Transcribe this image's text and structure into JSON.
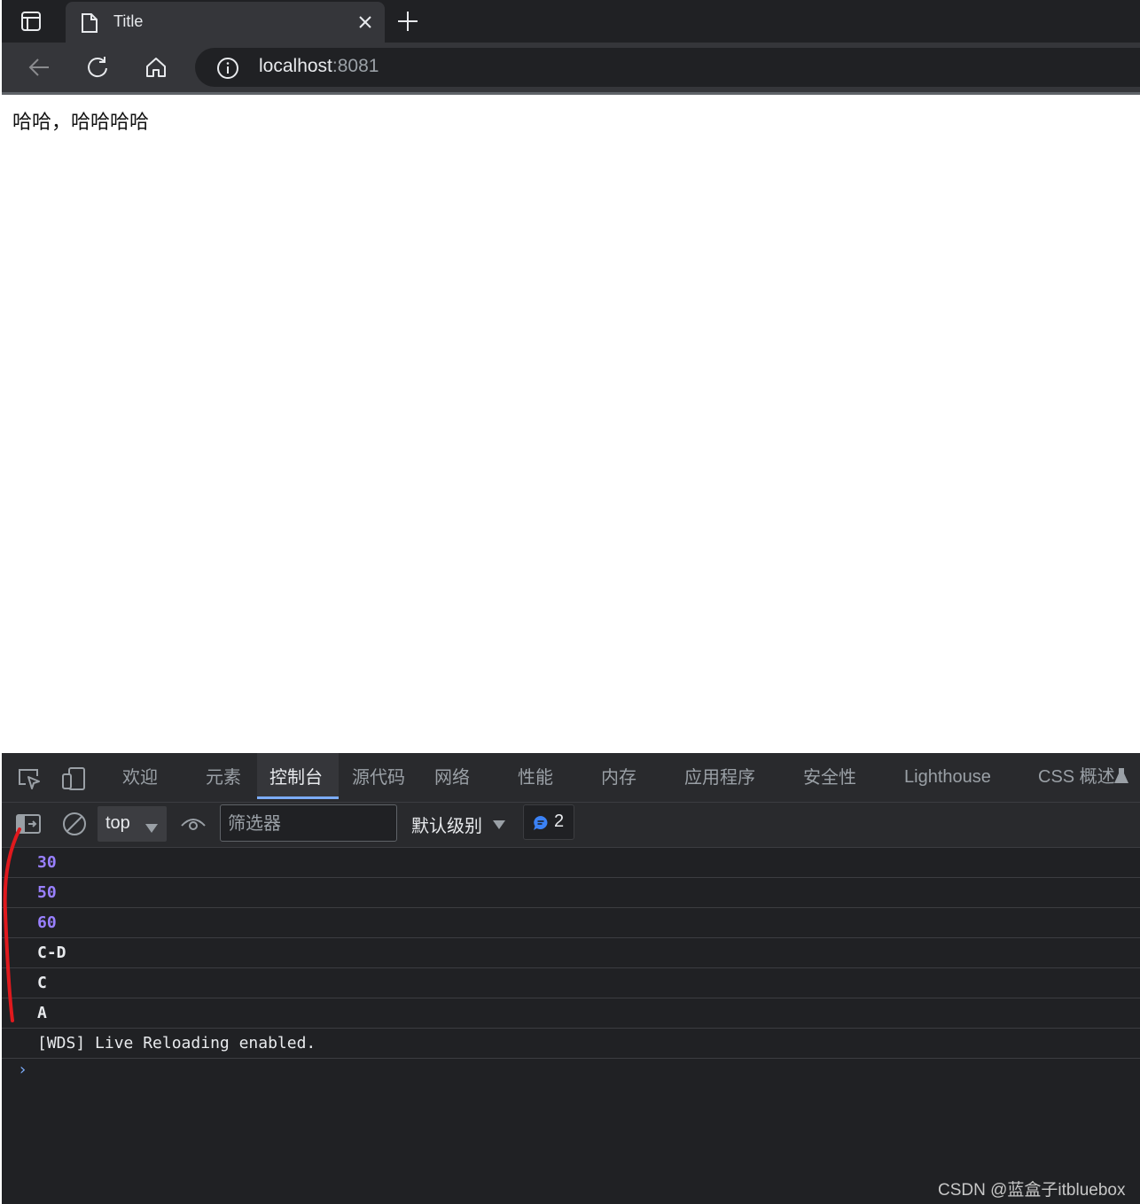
{
  "browser": {
    "tab_title": "Title",
    "url_host": "localhost",
    "url_port": ":8081"
  },
  "page": {
    "text": "哈哈，哈哈哈哈"
  },
  "devtools": {
    "tabs": [
      {
        "label": "欢迎"
      },
      {
        "label": "元素"
      },
      {
        "label": "控制台",
        "active": true
      },
      {
        "label": "源代码"
      },
      {
        "label": "网络"
      },
      {
        "label": "性能"
      },
      {
        "label": "内存"
      },
      {
        "label": "应用程序"
      },
      {
        "label": "安全性"
      },
      {
        "label": "Lighthouse"
      },
      {
        "label": "CSS 概述"
      }
    ],
    "toolbar": {
      "context": "top",
      "filter_placeholder": "筛选器",
      "levels": "默认级别",
      "issues_count": "2"
    },
    "console_lines": [
      {
        "text": "30",
        "kind": "number"
      },
      {
        "text": "50",
        "kind": "number"
      },
      {
        "text": "60",
        "kind": "number"
      },
      {
        "text": "C-D",
        "kind": "string"
      },
      {
        "text": "C",
        "kind": "string"
      },
      {
        "text": "A",
        "kind": "string"
      },
      {
        "text": "[WDS] Live Reloading enabled.",
        "kind": "log"
      }
    ],
    "prompt": "›"
  },
  "watermark": "CSDN @蓝盒子itbluebox",
  "colors": {
    "accent": "#7cacf8",
    "number": "#9980ff",
    "annotation": "#e0191d"
  }
}
